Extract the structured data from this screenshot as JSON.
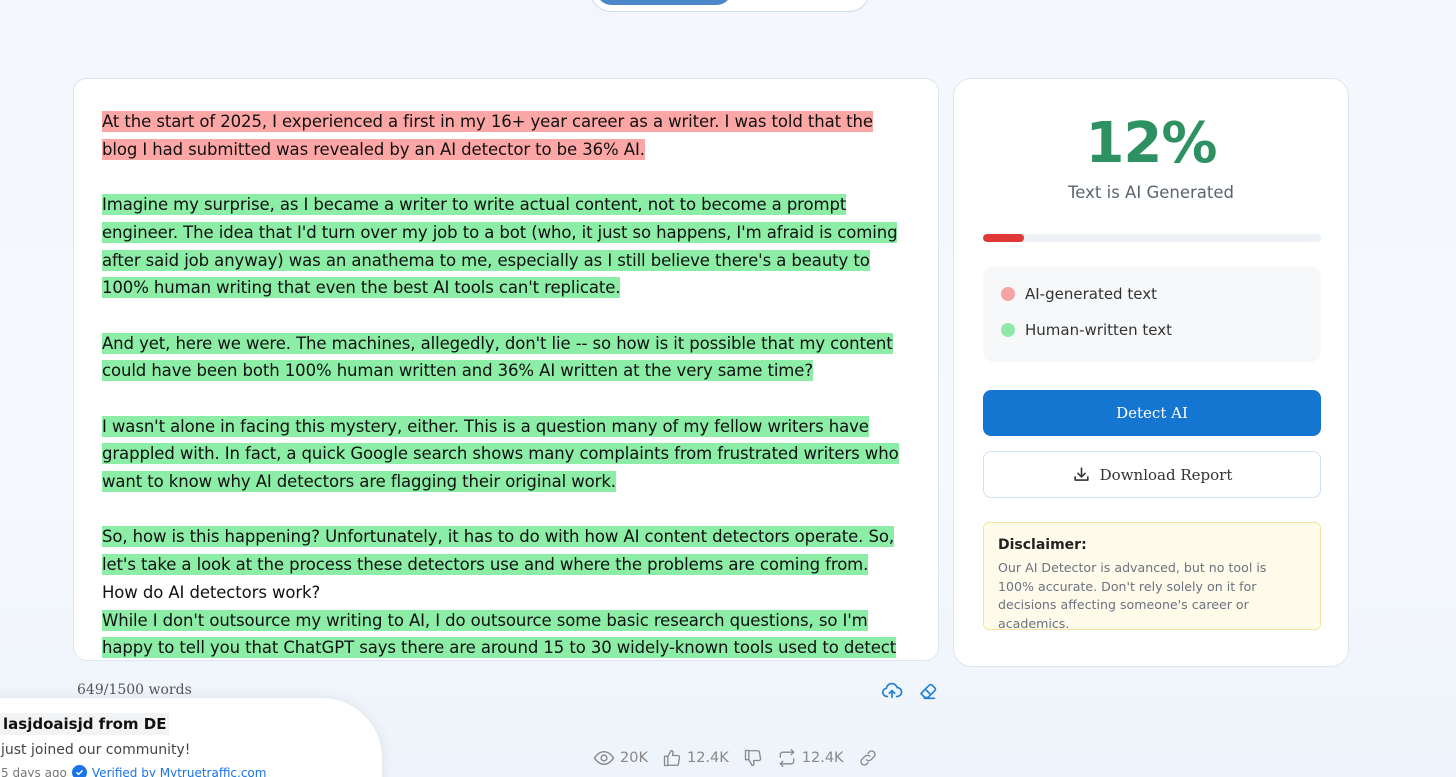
{
  "editor": {
    "paragraphs": [
      {
        "segments": [
          {
            "type": "ai",
            "text": "At the start of 2025, I experienced a first in my 16+ year career as a writer. I was told that the blog I had submitted was revealed by an AI detector to be 36% AI."
          }
        ]
      },
      {
        "segments": [
          {
            "type": "human",
            "text": "Imagine my surprise, as I became a writer to write actual content, not to become a prompt engineer. The idea that I'd turn over my job to a bot (who, it just so happens, I'm afraid is coming after said job anyway) was an anathema to me, especially as I still believe there's a beauty to 100% human writing that even the best AI tools can't replicate."
          }
        ]
      },
      {
        "segments": [
          {
            "type": "human",
            "text": "And yet, here we were. The machines, allegedly, don't lie -- so how is it possible that my content could have been both 100% human written and 36% AI written at the very same time?"
          }
        ]
      },
      {
        "segments": [
          {
            "type": "human",
            "text": "I wasn't alone in facing this mystery, either. This is a question many of my fellow writers have grappled with. In fact, a quick Google search shows many complaints from frustrated writers who want to know why AI detectors are flagging their original work."
          }
        ]
      },
      {
        "segments": [
          {
            "type": "human",
            "text": "So, how is this happening? Unfortunately, it has to do with how AI content detectors operate. So, let's take a look at the process these detectors use and where the problems are coming from."
          }
        ]
      },
      {
        "segments": [
          {
            "type": "plain",
            "text": "How do AI detectors work?"
          }
        ]
      },
      {
        "segments": [
          {
            "type": "human",
            "text": "While I don't outsource my writing to AI, I do outsource some basic research questions, so I'm happy to tell you that ChatGPT says there are around 15 to 30 widely-known tools used to detect AI content"
          }
        ]
      }
    ],
    "word_count": "649/1500 words"
  },
  "results": {
    "percentage": "12%",
    "percentage_value": 0.12,
    "label": "Text is AI Generated",
    "legend": [
      {
        "label": "AI-generated text",
        "color": "#f5a3a3"
      },
      {
        "label": "Human-written text",
        "color": "#8fe8a8"
      }
    ],
    "detect_label": "Detect AI",
    "download_label": "Download Report",
    "disclaimer_title": "Disclaimer:",
    "disclaimer_text": "Our AI Detector is advanced, but no tool is 100% accurate. Don't rely solely on it for decisions affecting someone's career or academics."
  },
  "toast": {
    "name": "lasjdoaisjd from DE",
    "message": "just joined our community!",
    "time": "5 days ago",
    "verified": "Verified by Mytruetraffic.com"
  },
  "stats": {
    "views": "20K",
    "likes": "12.4K",
    "reposts": "12.4K"
  },
  "colors": {
    "ai_highlight": "#fda6a6",
    "human_highlight": "#8ceda6",
    "percentage": "#2e9162",
    "primary": "#1576d1",
    "progress": "#e03838"
  },
  "icons": [
    "upload-icon",
    "eraser-icon",
    "download-icon",
    "check-icon",
    "eye-icon",
    "thumbs-up-icon",
    "thumbs-down-icon",
    "repost-icon",
    "link-icon"
  ]
}
